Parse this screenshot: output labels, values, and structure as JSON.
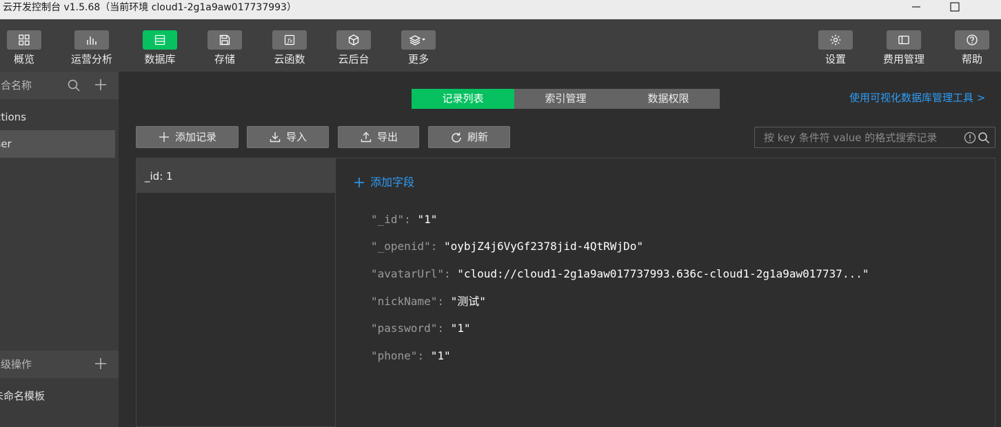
{
  "window": {
    "title": "云开发控制台 v1.5.68（当前环境 cloud1-2g1a9aw017737993）"
  },
  "toolbar": {
    "left_items": [
      {
        "label": "概览",
        "icon": "grid-icon"
      },
      {
        "label": "运营分析",
        "icon": "bar-chart-icon"
      },
      {
        "label": "数据库",
        "icon": "database-icon",
        "active": true
      },
      {
        "label": "存储",
        "icon": "save-icon"
      },
      {
        "label": "云函数",
        "icon": "function-icon"
      },
      {
        "label": "云后台",
        "icon": "cube-icon"
      },
      {
        "label": "更多",
        "icon": "layers-dropdown-icon"
      }
    ],
    "right_items": [
      {
        "label": "设置",
        "icon": "gear-icon"
      },
      {
        "label": "费用管理",
        "icon": "billing-icon"
      },
      {
        "label": "帮助",
        "icon": "help-icon"
      }
    ],
    "accent_color": "#07c160"
  },
  "sidebar": {
    "collections_header": "集合名称",
    "collections": [
      {
        "name": "actions",
        "selected": false
      },
      {
        "name": "user",
        "selected": true
      }
    ],
    "advanced_header": "高级操作",
    "templates": [
      {
        "name": "未命名模板"
      }
    ]
  },
  "tabs": [
    {
      "label": "记录列表",
      "active": true
    },
    {
      "label": "索引管理",
      "active": false
    },
    {
      "label": "数据权限",
      "active": false
    }
  ],
  "viz_tool_link": "使用可视化数据库管理工具 >",
  "actions": {
    "add_record": "添加记录",
    "import": "导入",
    "export": "导出",
    "refresh": "刷新"
  },
  "search": {
    "placeholder": "按 key 条件符 value 的格式搜索记录"
  },
  "records": [
    {
      "label": "_id: 1",
      "selected": true
    }
  ],
  "detail": {
    "add_field": "添加字段",
    "fields": [
      {
        "key": "\"_id\"",
        "value": "\"1\""
      },
      {
        "key": "\"_openid\"",
        "value": "\"oybjZ4j6VyGf2378jid-4QtRWjDo\""
      },
      {
        "key": "\"avatarUrl\"",
        "value": "\"cloud://cloud1-2g1a9aw017737993.636c-cloud1-2g1a9aw017737...\""
      },
      {
        "key": "\"nickName\"",
        "value": "\"测试\""
      },
      {
        "key": "\"password\"",
        "value": "\"1\""
      },
      {
        "key": "\"phone\"",
        "value": "\"1\""
      }
    ]
  },
  "colors": {
    "link": "#2e9cf5",
    "active_tab": "#07c160"
  }
}
